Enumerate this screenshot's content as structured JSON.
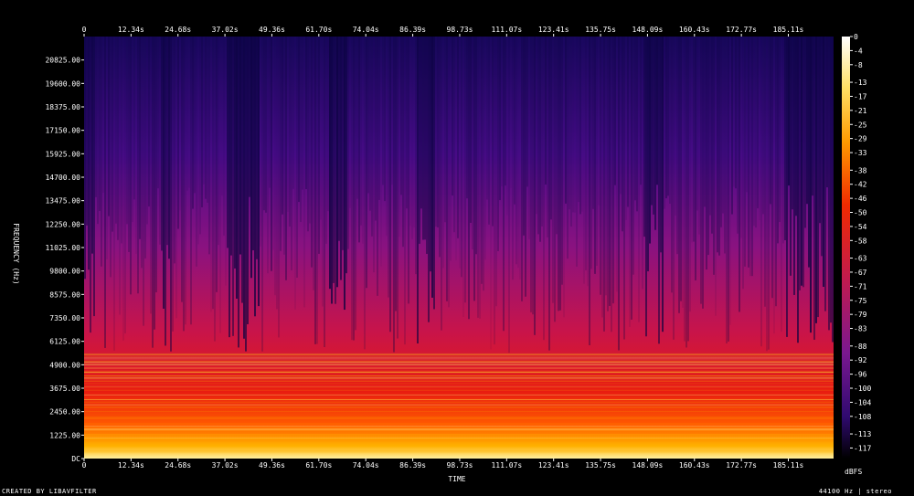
{
  "chart_data": {
    "type": "heatmap",
    "xlabel": "TIME",
    "ylabel": "FREQUENCY (Hz)",
    "x_ticks": [
      "0",
      "12.34s",
      "24.68s",
      "37.02s",
      "49.36s",
      "61.70s",
      "74.04s",
      "86.39s",
      "98.73s",
      "111.07s",
      "123.41s",
      "135.75s",
      "148.09s",
      "160.43s",
      "172.77s",
      "185.11s"
    ],
    "x_tick_values": [
      0,
      12.34,
      24.68,
      37.02,
      49.36,
      61.7,
      74.04,
      86.39,
      98.73,
      111.07,
      123.41,
      135.75,
      148.09,
      160.43,
      172.77,
      185.11
    ],
    "xlim": [
      0,
      197
    ],
    "y_ticks": [
      "DC",
      "1225.00",
      "2450.00",
      "3675.00",
      "4900.00",
      "6125.00",
      "7350.00",
      "8575.00",
      "9800.00",
      "11025.00",
      "12250.00",
      "13475.00",
      "14700.00",
      "15925.00",
      "17150.00",
      "18375.00",
      "19600.00",
      "20825.00"
    ],
    "y_tick_values": [
      0,
      1225,
      2450,
      3675,
      4900,
      6125,
      7350,
      8575,
      9800,
      11025,
      12250,
      13475,
      14700,
      15925,
      17150,
      18375,
      19600,
      20825
    ],
    "ylim": [
      0,
      22050
    ],
    "colorbar_label": "dBFS",
    "colorbar_ticks": [
      "0",
      "-4",
      "-8",
      "-13",
      "-17",
      "-21",
      "-25",
      "-29",
      "-33",
      "-38",
      "-42",
      "-46",
      "-50",
      "-54",
      "-58",
      "-63",
      "-67",
      "-71",
      "-75",
      "-79",
      "-83",
      "-88",
      "-92",
      "-96",
      "-100",
      "-104",
      "-108",
      "-113",
      "-117"
    ],
    "colorbar_range": [
      0,
      -120
    ],
    "colormap": [
      "#000000",
      "#1a0050",
      "#4b0a8c",
      "#8c1a9a",
      "#c81e5a",
      "#e8200a",
      "#ff7800",
      "#ffd200",
      "#ffffff"
    ],
    "grid": false
  },
  "footer": {
    "created_by": "CREATED BY LIBAVFILTER",
    "sample_info": "44100 Hz | stereo"
  }
}
